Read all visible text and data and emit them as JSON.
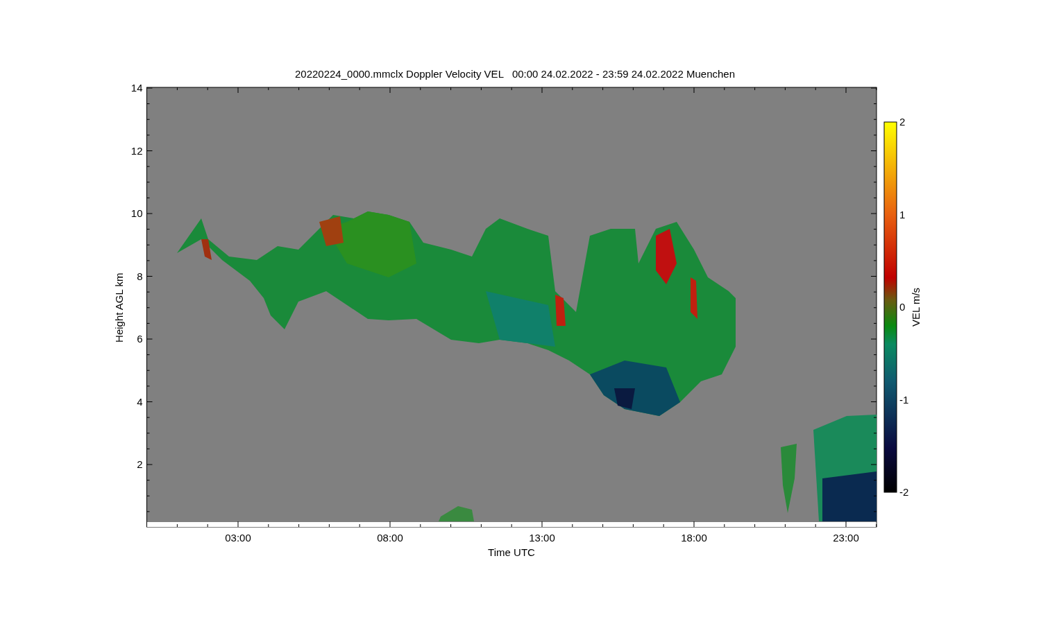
{
  "title": "20220224_0000.mmclx Doppler Velocity VEL   00:00 24.02.2022 - 23:59 24.02.2022 Muenchen",
  "y_axis": {
    "label": "Height AGL km",
    "ticks": [
      "14",
      "12",
      "10",
      "8",
      "6",
      "4",
      "2"
    ]
  },
  "x_axis": {
    "label": "Time UTC",
    "ticks": [
      "03:00",
      "08:00",
      "13:00",
      "18:00",
      "23:00"
    ]
  },
  "colorbar": {
    "label": "VEL m/s",
    "ticks": [
      "2",
      "1",
      "0",
      "-1",
      "-2"
    ]
  }
}
